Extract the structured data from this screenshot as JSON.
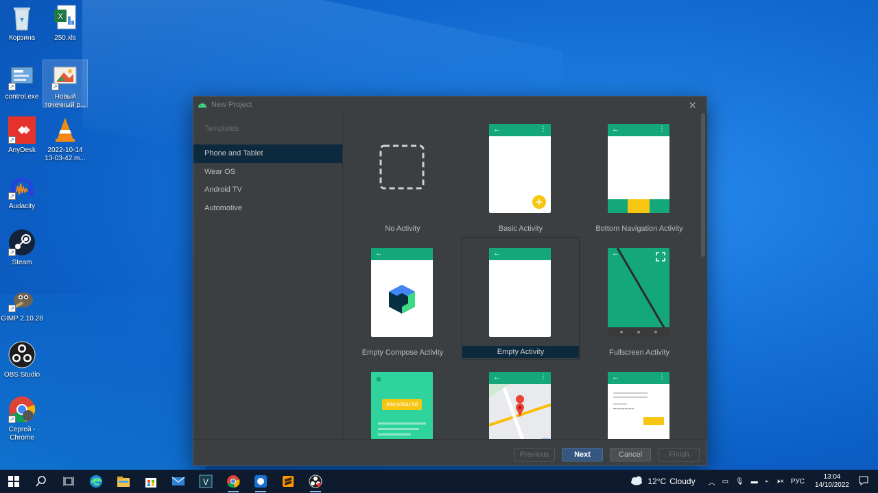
{
  "desktop": {
    "icons": [
      {
        "label": "Корзина",
        "icon": "recycle-bin-icon"
      },
      {
        "label": "250.xls",
        "icon": "excel-file-icon"
      },
      {
        "label": "control.exe",
        "icon": "control-panel-icon"
      },
      {
        "label": "Новый точечный р...",
        "icon": "image-file-icon"
      },
      {
        "label": "AnyDesk",
        "icon": "anydesk-icon"
      },
      {
        "label": "2022-10-14 13-03-42.m...",
        "icon": "vlc-file-icon"
      },
      {
        "label": "Audacity",
        "icon": "audacity-icon"
      },
      {
        "label": "Steam",
        "icon": "steam-icon"
      },
      {
        "label": "GIMP 2.10.28",
        "icon": "gimp-icon"
      },
      {
        "label": "OBS Studio",
        "icon": "obs-icon"
      },
      {
        "label": "Сергей - Chrome",
        "icon": "chrome-icon"
      }
    ]
  },
  "dialog": {
    "title": "New Project",
    "sidebar": {
      "header": "Templates",
      "items": [
        "Phone and Tablet",
        "Wear OS",
        "Android TV",
        "Automotive"
      ],
      "selected_index": 0
    },
    "templates": [
      {
        "label": "No Activity"
      },
      {
        "label": "Basic Activity"
      },
      {
        "label": "Bottom Navigation Activity"
      },
      {
        "label": "Empty Compose Activity"
      },
      {
        "label": "Empty Activity"
      },
      {
        "label": "Fullscreen Activity"
      },
      {
        "label": "",
        "badge": "Interstitial Ad"
      },
      {
        "label": ""
      },
      {
        "label": ""
      }
    ],
    "selected_template_index": 4,
    "buttons": {
      "previous": "Previous",
      "next": "Next",
      "cancel": "Cancel",
      "finish": "Finish"
    },
    "accent_color": "#13a779"
  },
  "taskbar": {
    "apps": [
      "start-icon",
      "search-icon",
      "task-view-icon",
      "edge-icon",
      "file-explorer-icon",
      "store-icon",
      "mail-icon",
      "vim-icon",
      "chrome-icon",
      "unknown-app-icon",
      "sublime-icon",
      "obs-icon"
    ],
    "weather": {
      "temp": "12°C",
      "condition": "Cloudy"
    },
    "language": "РУС",
    "time": "13:04",
    "date": "14/10/2022"
  }
}
